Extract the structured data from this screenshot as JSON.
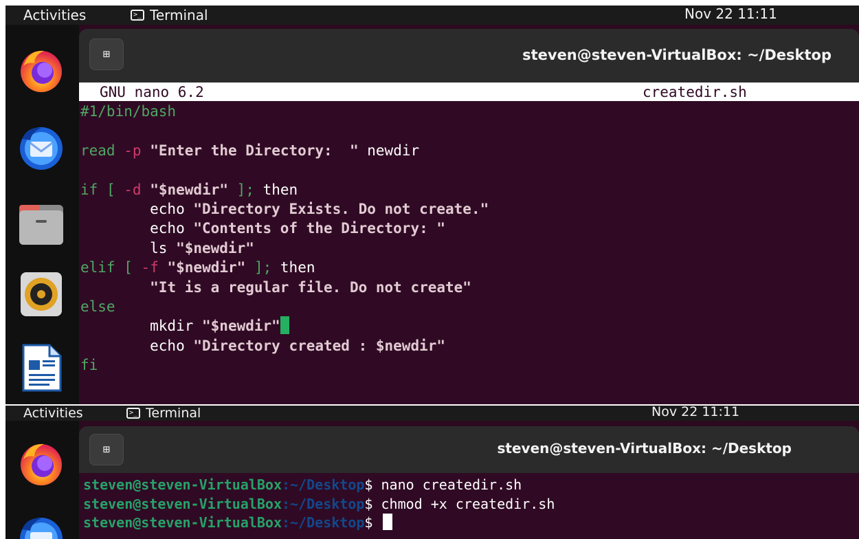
{
  "shot1": {
    "topbar": {
      "activities": "Activities",
      "app_name": "Terminal",
      "clock": "Nov 22  11:11"
    },
    "dock": {
      "items": [
        "firefox-icon",
        "thunderbird-icon",
        "files-icon",
        "rhythmbox-icon",
        "libreoffice-writer-icon"
      ]
    },
    "window": {
      "title": "steven@steven-VirtualBox: ~/Desktop",
      "new_tab_symbol": "⊞"
    },
    "nano": {
      "version": "GNU nano 6.2",
      "filename": "createdir.sh",
      "lines": [
        "#1/bin/bash",
        "",
        "read -p \"Enter the Directory:  \" newdir",
        "",
        "if [ -d \"$newdir\" ]; then",
        "        echo \"Directory Exists. Do not create.\"",
        "        echo \"Contents of the Directory: \"",
        "        ls \"$newdir\"",
        "elif [ -f \"$newdir\" ]; then",
        "        \"It is a regular file. Do not create\"",
        "else",
        "        mkdir \"$newdir\"",
        "        echo \"Directory created : $newdir\"",
        "fi"
      ]
    }
  },
  "shot2": {
    "topbar": {
      "activities": "Activities",
      "app_name": "Terminal",
      "clock": "Nov 22  11:11"
    },
    "dock": {
      "items": [
        "firefox-icon",
        "thunderbird-icon"
      ]
    },
    "window": {
      "title": "steven@steven-VirtualBox: ~/Desktop",
      "new_tab_symbol": "⊞"
    },
    "terminal": {
      "prompt_user": "steven@steven-VirtualBox",
      "prompt_path": ":~/Desktop",
      "prompt_symbol": "$",
      "commands": [
        "nano createdir.sh",
        "chmod +x createdir.sh",
        ""
      ]
    }
  },
  "colors": {
    "terminal_bg": "#300a24",
    "prompt_green": "#26a269",
    "prompt_blue": "#12488b",
    "cursor_green": "#24b060"
  }
}
